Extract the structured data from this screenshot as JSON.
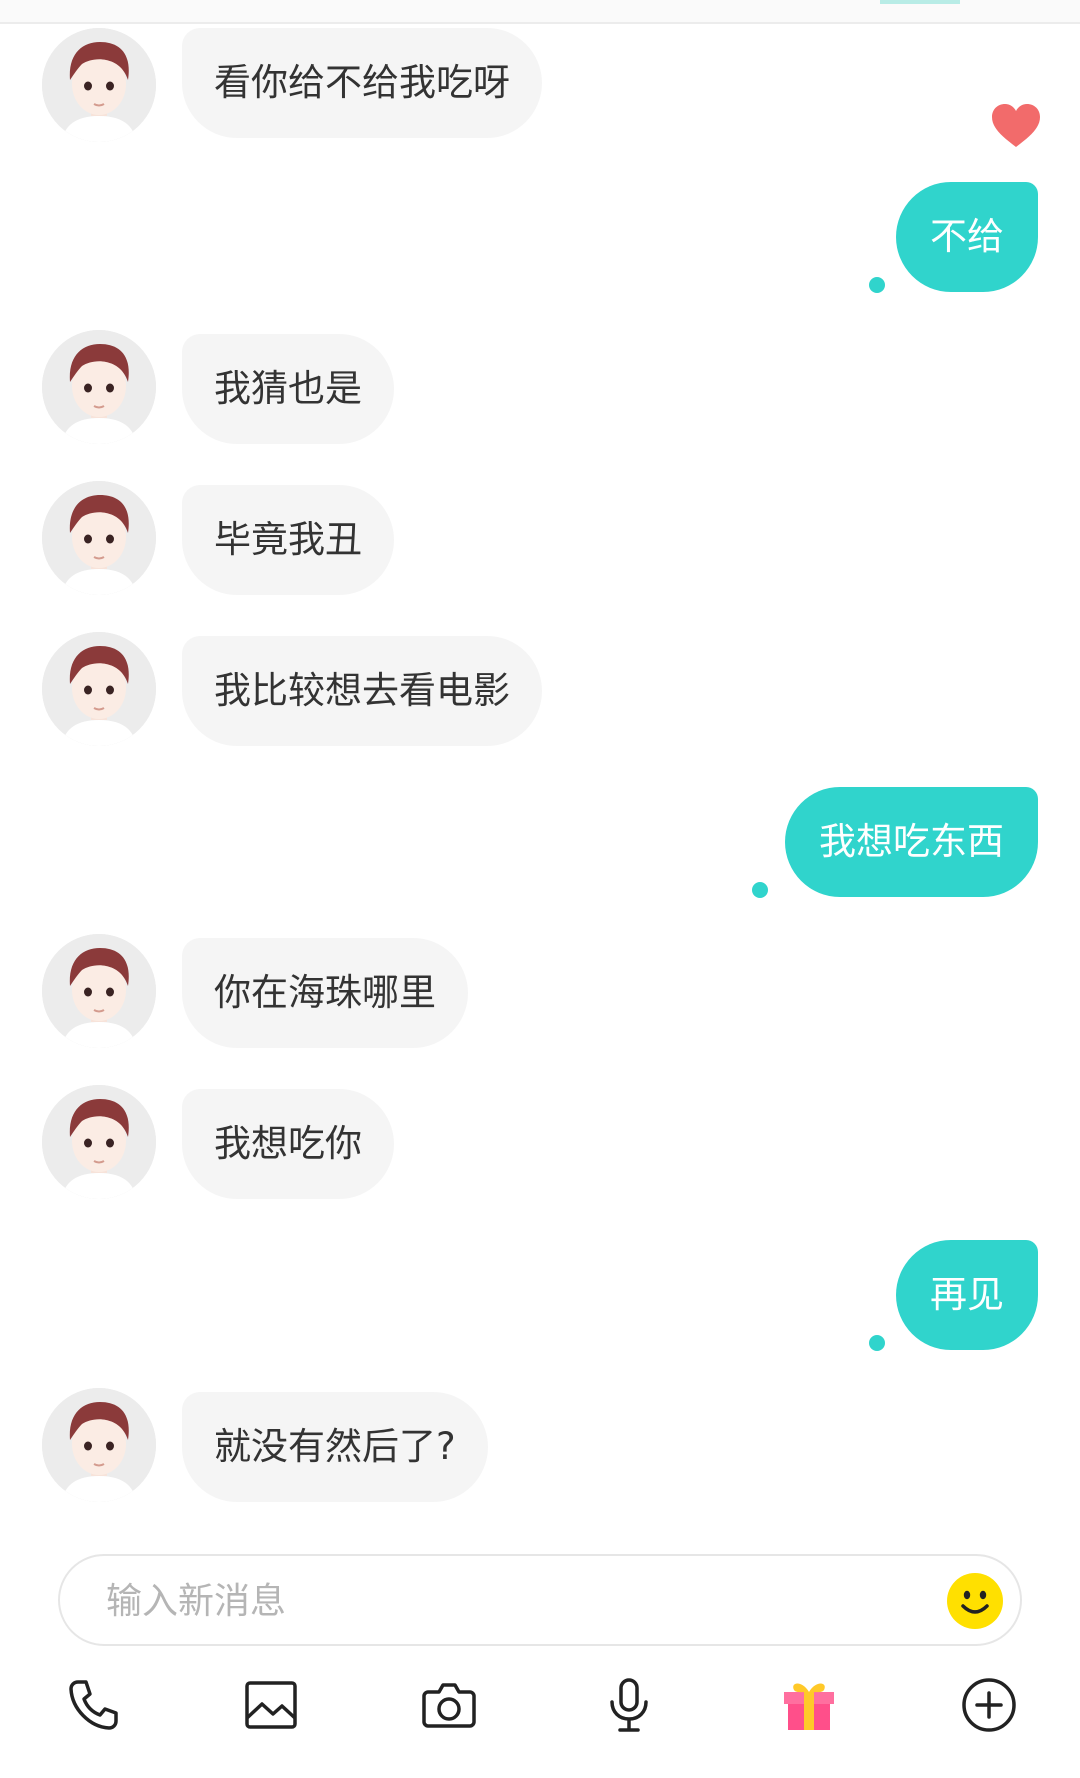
{
  "messages": [
    {
      "side": "in",
      "text": "看你给不给我吃呀"
    },
    {
      "side": "out",
      "text": "不给"
    },
    {
      "side": "in",
      "text": "我猜也是"
    },
    {
      "side": "in",
      "text": "毕竟我丑"
    },
    {
      "side": "in",
      "text": "我比较想去看电影"
    },
    {
      "side": "out",
      "text": "我想吃东西"
    },
    {
      "side": "in",
      "text": "你在海珠哪里"
    },
    {
      "side": "in",
      "text": "我想吃你"
    },
    {
      "side": "out",
      "text": "再见"
    },
    {
      "side": "in",
      "text": "就没有然后了?"
    }
  ],
  "composer": {
    "placeholder": "输入新消息",
    "emoji_icon": "smiley-emoji-icon"
  },
  "toolbar": {
    "icons": [
      "phone-icon",
      "image-icon",
      "camera-icon",
      "microphone-icon",
      "gift-icon",
      "plus-circle-icon"
    ]
  },
  "colors": {
    "accent": "#30d4cc",
    "incoming_bubble": "#f5f5f5",
    "heart": "#f26b6b",
    "emoji": "#ffe000"
  }
}
